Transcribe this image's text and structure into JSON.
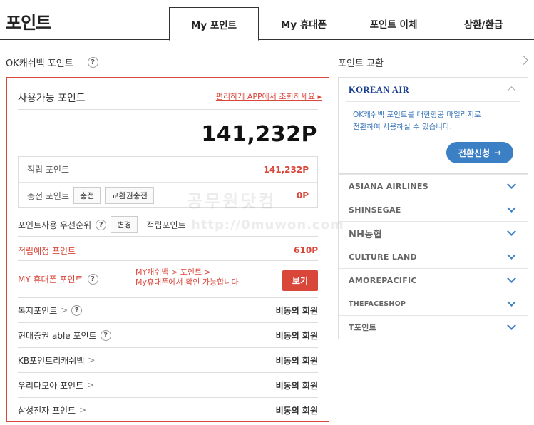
{
  "page_title": "포인트",
  "tabs": [
    "My 포인트",
    "My 휴대폰",
    "포인트 이체",
    "상환/환급"
  ],
  "left_section": {
    "title": "OK캐쉬백 포인트",
    "help": "?",
    "available_label": "사용가능 포인트",
    "app_link": "편리하게 APP에서 조회하세요",
    "available_value": "141,232P",
    "accrued_label": "적립 포인트",
    "accrued_value": "141,232P",
    "charge_label": "충전 포인트",
    "charge_btn": "충전",
    "voucher_btn": "교환권충전",
    "charge_value": "0P",
    "priority_label": "포인트사용 우선순위",
    "priority_btn": "변경",
    "priority_value": "적립포인트",
    "expected_label": "적립예정 포인트",
    "expected_value": "610P",
    "phone_label": "MY 휴대폰 포인트",
    "phone_note_1": "MY캐쉬백 > 포인트 >",
    "phone_note_2": "My휴대폰에서 확인 가능합니다",
    "view_btn": "보기",
    "list": [
      {
        "label": "복지포인트",
        "value": "비동의 회원"
      },
      {
        "label": "현대증권 able 포인트",
        "value": "비동의 회원"
      },
      {
        "label": "KB포인트리캐쉬백",
        "value": "비동의 회원"
      },
      {
        "label": "우리다모아 포인트",
        "value": "비동의 회원"
      },
      {
        "label": "삼성전자 포인트",
        "value": "비동의 회원"
      }
    ]
  },
  "right_section": {
    "title": "포인트 교환",
    "korean_air": "KOREAN AIR",
    "ka_desc_1": "OK캐쉬백 포인트를 대한항공 마일리지로",
    "ka_desc_2": "전환하여 사용하실 수 있습니다.",
    "ka_btn": "전환신청",
    "partners": [
      "ASIANA AIRLINES",
      "SHINSEGAE",
      "NH농협",
      "CULTURE LAND",
      "AMOREPACIFIC",
      "THEFACESHOP",
      "T포인트"
    ]
  },
  "watermark_1": "공무원닷컴",
  "watermark_2": "http://0muwon.com"
}
